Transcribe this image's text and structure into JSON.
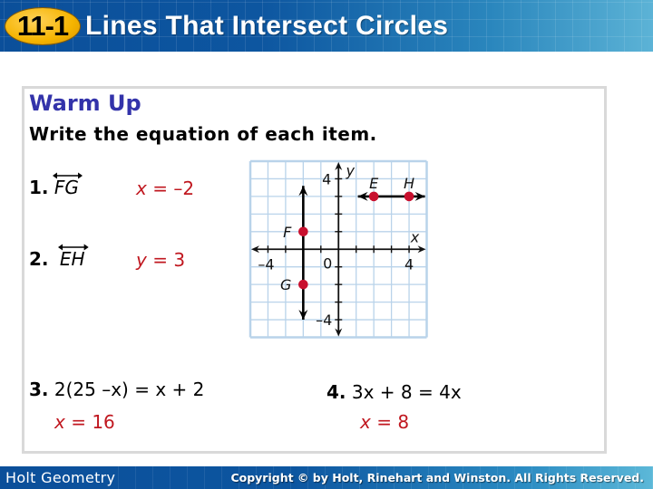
{
  "header": {
    "lesson_number": "11-1",
    "title": "Lines That Intersect Circles"
  },
  "warm_up": {
    "heading": "Warm Up",
    "instructions": "Write the equation of each item."
  },
  "items": [
    {
      "number": "1.",
      "label": "FG",
      "label_type": "line",
      "answer_var": "x",
      "answer": " = –2"
    },
    {
      "number": "2.",
      "label": "EH",
      "label_type": "line",
      "answer_var": "y",
      "answer": " = 3"
    },
    {
      "number": "3.",
      "equation": "2(25 –x) = x + 2",
      "answer_var": "x",
      "answer": " = 16"
    },
    {
      "number": "4.",
      "equation": "3x + 8 = 4x",
      "answer_var": "x",
      "answer": " = 8"
    }
  ],
  "graph": {
    "x_range": [
      -5,
      5
    ],
    "y_range": [
      -5,
      5
    ],
    "x_axis_label": "x",
    "y_axis_label": "y",
    "tick_labels": {
      "x_neg": "–4",
      "x_pos": "4",
      "y_pos": "4",
      "y_neg": "–4",
      "origin": "0"
    },
    "points": [
      {
        "name": "E",
        "x": 2,
        "y": 3
      },
      {
        "name": "H",
        "x": 4,
        "y": 3
      },
      {
        "name": "F",
        "x": -2,
        "y": 1
      },
      {
        "name": "G",
        "x": -2,
        "y": -2
      }
    ],
    "lines": [
      {
        "name": "EH",
        "from": [
          1.1,
          3
        ],
        "to": [
          4.9,
          3
        ]
      },
      {
        "name": "FG",
        "from": [
          -2,
          -4
        ],
        "to": [
          -2,
          3.6
        ]
      }
    ],
    "colors": {
      "grid": "#b9d3ea",
      "point": "#c8102e",
      "axis": "#111111"
    }
  },
  "footer": {
    "left": "Holt Geometry",
    "right": "Copyright © by Holt, Rinehart and Winston. All Rights Reserved."
  }
}
